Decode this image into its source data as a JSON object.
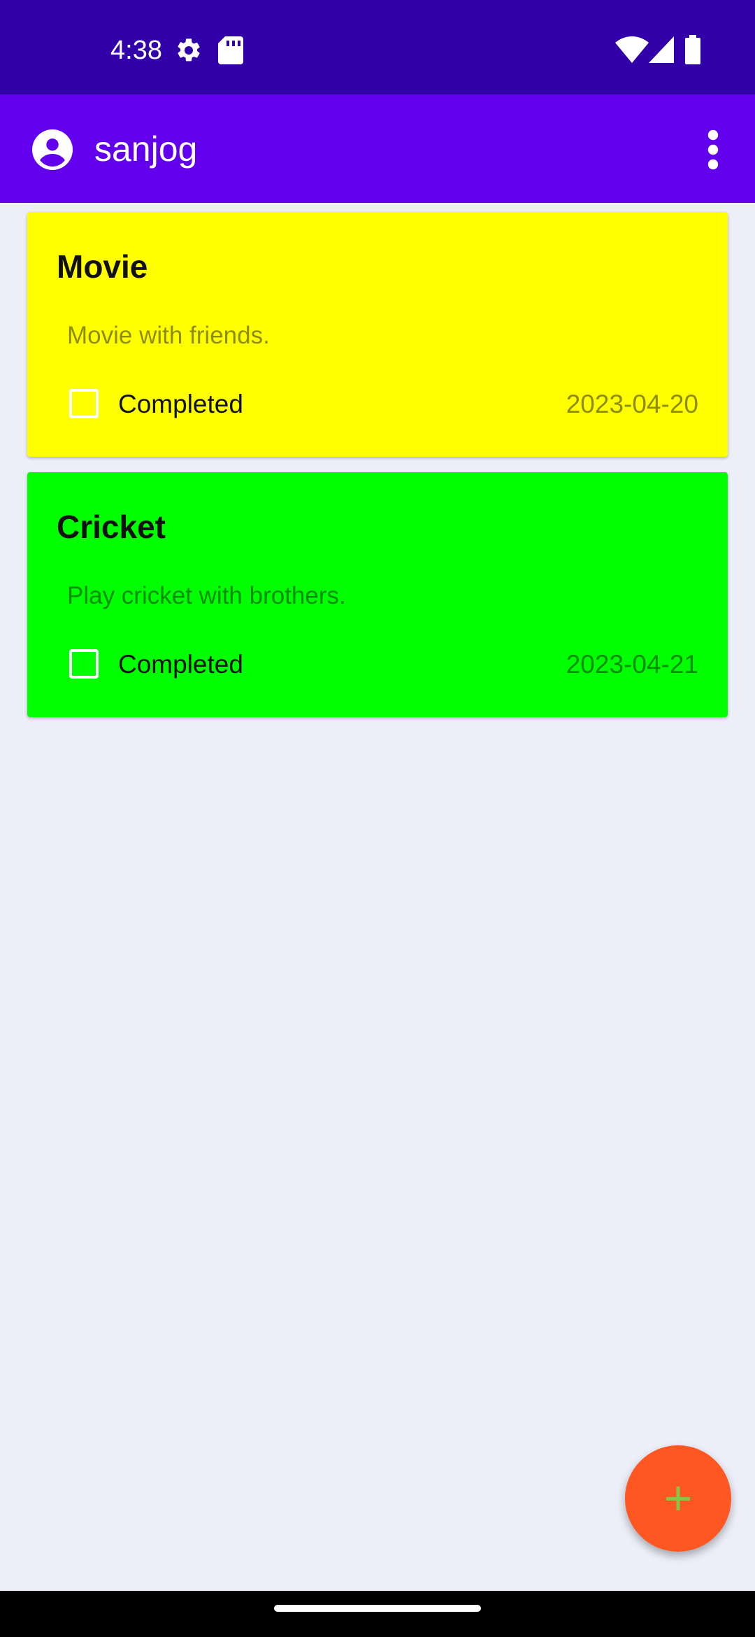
{
  "status_bar": {
    "time": "4:38",
    "icons": [
      "settings-icon",
      "sd-card-icon",
      "wifi-icon",
      "signal-icon",
      "battery-icon"
    ]
  },
  "app_bar": {
    "title": "sanjog",
    "leading_icon": "account-circle-icon",
    "trailing_icon": "more-vert-icon",
    "color": "#6200EE"
  },
  "notes": [
    {
      "title": "Movie",
      "description": "Movie with friends.",
      "checkbox_label": "Completed",
      "checked": false,
      "date": "2023-04-20",
      "color": "#FFFF00"
    },
    {
      "title": "Cricket",
      "description": "Play cricket with brothers.",
      "checkbox_label": "Completed",
      "checked": false,
      "date": "2023-04-21",
      "color": "#00FF00"
    }
  ],
  "fab": {
    "icon": "add-icon",
    "color": "#FF5722",
    "icon_color": "#8BC34A"
  },
  "colors": {
    "status_bar": "#3100A8",
    "background": "#ECEEF8"
  }
}
